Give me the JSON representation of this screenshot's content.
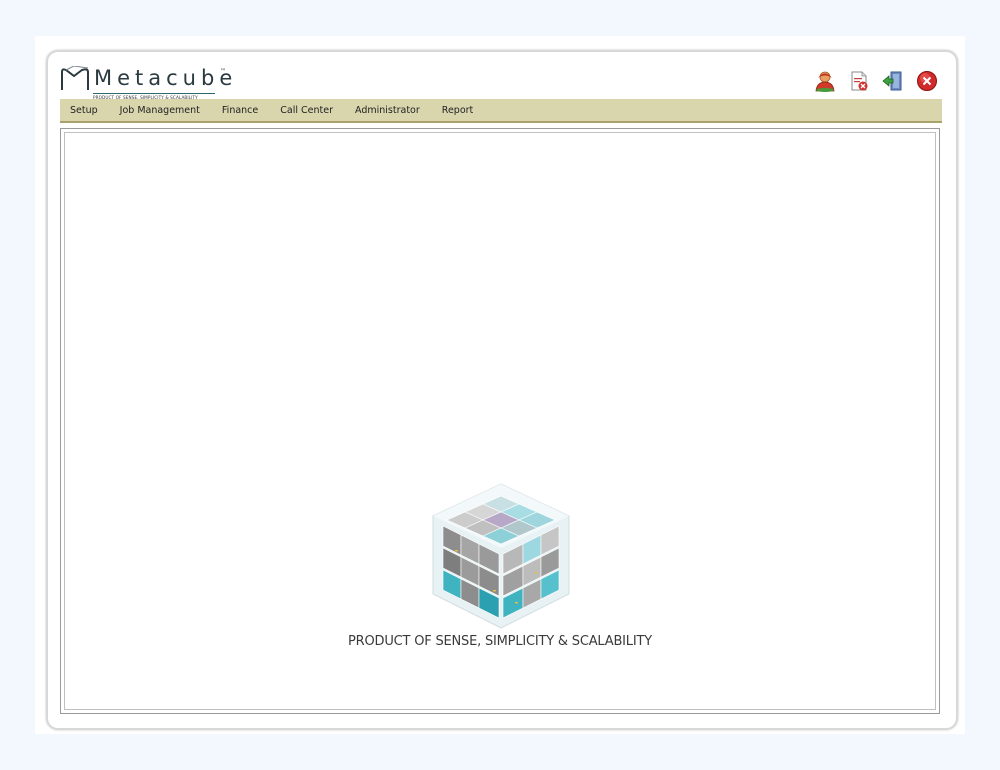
{
  "logo": {
    "wordmark": "Metacube",
    "trademark": "™",
    "tagline": "PRODUCT OF SENSE, SIMPLICITY & SCALABILITY"
  },
  "header_icons": [
    {
      "name": "user-profile-icon"
    },
    {
      "name": "document-delete-icon"
    },
    {
      "name": "logout-door-icon"
    },
    {
      "name": "close-icon"
    }
  ],
  "menu": {
    "items": [
      {
        "label": "Setup"
      },
      {
        "label": "Job Management"
      },
      {
        "label": "Finance"
      },
      {
        "label": "Call Center"
      },
      {
        "label": "Administrator"
      },
      {
        "label": "Report"
      }
    ]
  },
  "main": {
    "tagline": "PRODUCT OF SENSE, SIMPLICITY &  SCALABILITY"
  },
  "colors": {
    "menubar_bg": "#d9d6ae",
    "menubar_border": "#a9a26a",
    "page_bg": "#f2f8fd",
    "cube_teal": "#3fb3c0",
    "cube_gray": "#8a8a8a"
  }
}
